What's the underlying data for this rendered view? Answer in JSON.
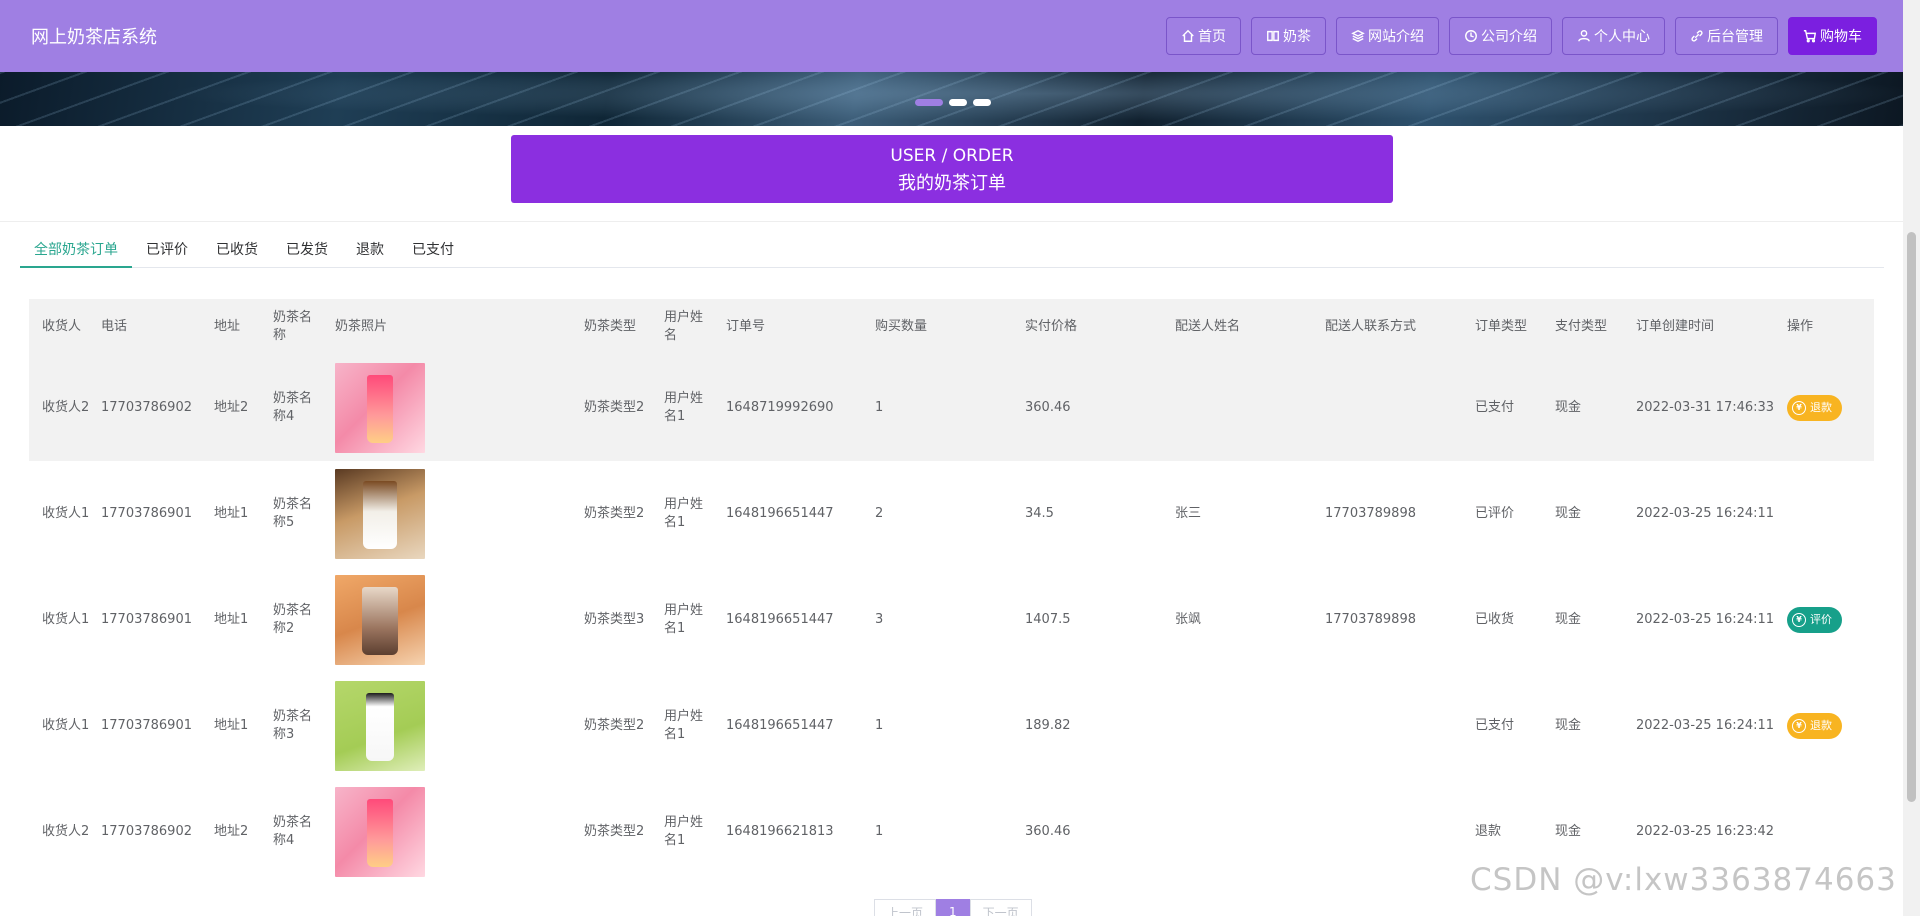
{
  "header": {
    "title": "网上奶茶店系统",
    "nav": [
      {
        "label": "首页",
        "icon": "home-icon"
      },
      {
        "label": "奶茶",
        "icon": "book-icon"
      },
      {
        "label": "网站介绍",
        "icon": "layers-icon"
      },
      {
        "label": "公司介绍",
        "icon": "clock-icon"
      },
      {
        "label": "个人中心",
        "icon": "user-icon"
      },
      {
        "label": "后台管理",
        "icon": "link-icon"
      },
      {
        "label": "购物车",
        "icon": "cart-icon",
        "active": true
      }
    ]
  },
  "page_title": {
    "en": "USER / ORDER",
    "zh": "我的奶茶订单"
  },
  "tabs": [
    "全部奶茶订单",
    "已评价",
    "已收货",
    "已发货",
    "退款",
    "已支付"
  ],
  "table": {
    "headers": [
      "收货人",
      "电话",
      "地址",
      "奶茶名称",
      "奶茶照片",
      "奶茶类型",
      "用户姓名",
      "订单号",
      "购买数量",
      "实付价格",
      "配送人姓名",
      "配送人联系方式",
      "订单类型",
      "支付类型",
      "订单创建时间",
      "操作"
    ],
    "rows": [
      {
        "consignee": "收货人2",
        "phone": "17703786902",
        "address": "地址2",
        "name": "奶茶名称4",
        "photo": "pink",
        "type": "奶茶类型2",
        "user": "用户姓名1",
        "order_no": "1648719992690",
        "qty": "1",
        "price": "360.46",
        "courier": "",
        "courier_phone": "",
        "status": "已支付",
        "pay": "现金",
        "created": "2022-03-31 17:46:33",
        "action": "退款",
        "action_type": "refund"
      },
      {
        "consignee": "收货人1",
        "phone": "17703786901",
        "address": "地址1",
        "name": "奶茶名称5",
        "photo": "caramel",
        "type": "奶茶类型2",
        "user": "用户姓名1",
        "order_no": "1648196651447",
        "qty": "2",
        "price": "34.5",
        "courier": "张三",
        "courier_phone": "17703789898",
        "status": "已评价",
        "pay": "现金",
        "created": "2022-03-25 16:24:11",
        "action": "",
        "action_type": ""
      },
      {
        "consignee": "收货人1",
        "phone": "17703786901",
        "address": "地址1",
        "name": "奶茶名称2",
        "photo": "milk",
        "type": "奶茶类型3",
        "user": "用户姓名1",
        "order_no": "1648196651447",
        "qty": "3",
        "price": "1407.5",
        "courier": "张飒",
        "courier_phone": "17703789898",
        "status": "已收货",
        "pay": "现金",
        "created": "2022-03-25 16:24:11",
        "action": "评价",
        "action_type": "review"
      },
      {
        "consignee": "收货人1",
        "phone": "17703786901",
        "address": "地址1",
        "name": "奶茶名称3",
        "photo": "green",
        "type": "奶茶类型2",
        "user": "用户姓名1",
        "order_no": "1648196651447",
        "qty": "1",
        "price": "189.82",
        "courier": "",
        "courier_phone": "",
        "status": "已支付",
        "pay": "现金",
        "created": "2022-03-25 16:24:11",
        "action": "退款",
        "action_type": "refund"
      },
      {
        "consignee": "收货人2",
        "phone": "17703786902",
        "address": "地址2",
        "name": "奶茶名称4",
        "photo": "pink",
        "type": "奶茶类型2",
        "user": "用户姓名1",
        "order_no": "1648196621813",
        "qty": "1",
        "price": "360.46",
        "courier": "",
        "courier_phone": "",
        "status": "退款",
        "pay": "现金",
        "created": "2022-03-25 16:23:42",
        "action": "",
        "action_type": ""
      }
    ]
  },
  "pager": {
    "prev": "上一页",
    "current": "1",
    "next": "下一页"
  },
  "watermark": "CSDN @v:lxw3363874663",
  "colors": {
    "header": "#9f7fe3",
    "accent": "#8b2fe0",
    "tab_active": "#2aa68f",
    "refund": "#f8b421",
    "review": "#17a08a"
  }
}
